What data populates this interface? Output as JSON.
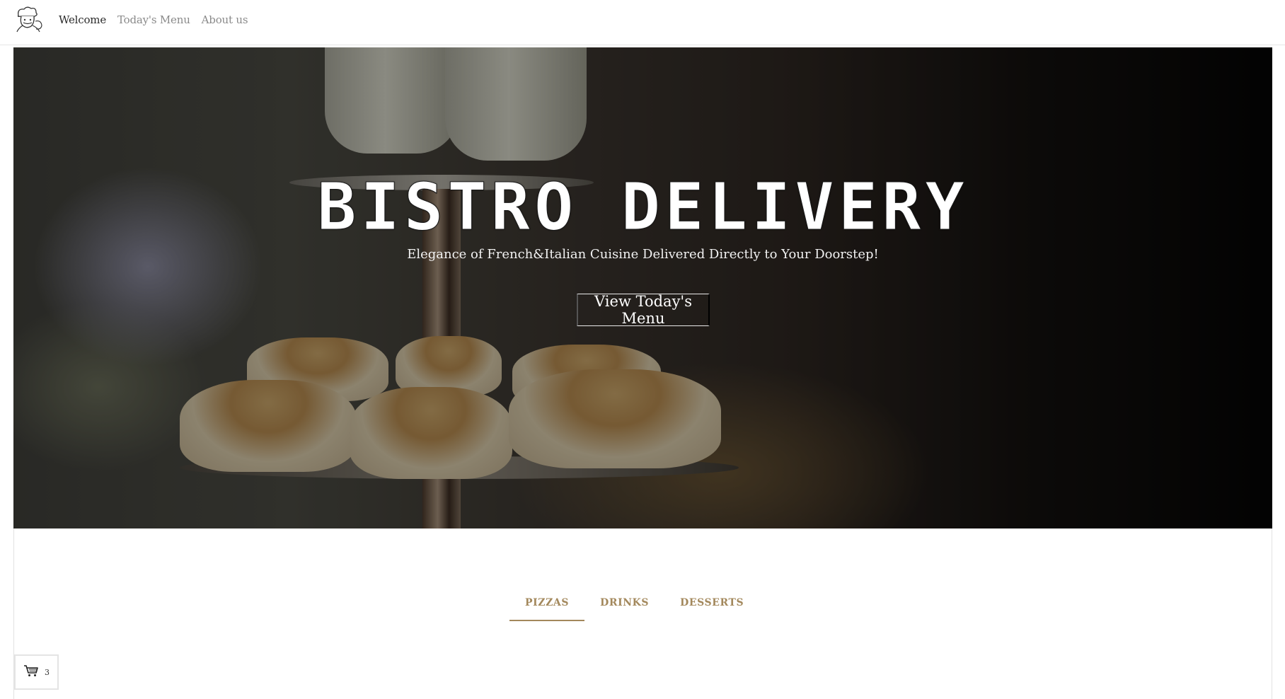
{
  "nav": {
    "logo_icon": "chef-logo-icon",
    "links": [
      {
        "label": "Welcome",
        "active": true
      },
      {
        "label": "Today's Menu",
        "active": false
      },
      {
        "label": "About us",
        "active": false
      }
    ]
  },
  "hero": {
    "title": "BISTRO DELIVERY",
    "subtitle": "Elegance of French&Italian Cuisine Delivered Directly to Your Doorstep!",
    "cta_label": "View Today's Menu"
  },
  "menu_tabs": [
    {
      "label": "PIZZAS",
      "active": true
    },
    {
      "label": "DRINKS",
      "active": false
    },
    {
      "label": "DESSERTS",
      "active": false
    }
  ],
  "cart": {
    "icon": "cart-icon",
    "count": "3"
  },
  "colors": {
    "accent": "#a3885c",
    "nav_active": "#2b2b2b",
    "nav_inactive": "#8a8a8a"
  }
}
